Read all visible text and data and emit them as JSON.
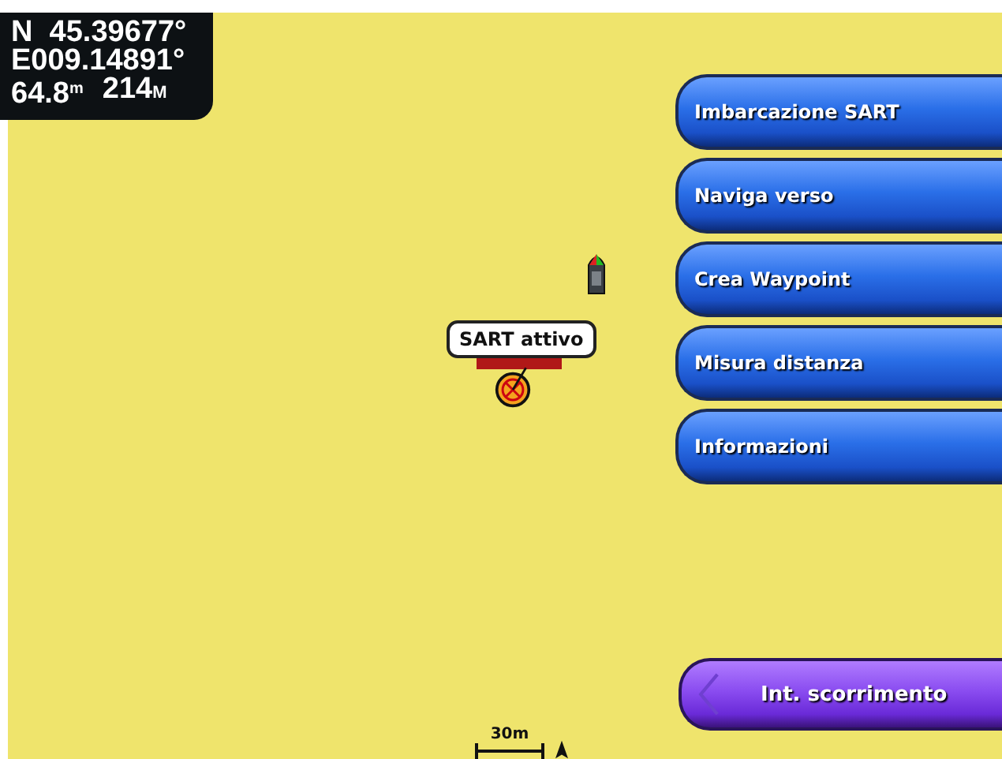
{
  "position": {
    "lat": "N  45.39677°",
    "lon": "E009.14891°",
    "accuracy": "64.8",
    "accuracy_unit": "m",
    "heading": "214",
    "heading_unit": "M"
  },
  "marker": {
    "label": "SART attivo"
  },
  "menu": [
    {
      "label": "Imbarcazione SART"
    },
    {
      "label": "Naviga verso"
    },
    {
      "label": "Crea Waypoint"
    },
    {
      "label": "Misura distanza"
    },
    {
      "label": "Informazioni"
    }
  ],
  "scroll_button": {
    "label": "Int. scorrimento"
  },
  "scale": {
    "label": "30m"
  }
}
